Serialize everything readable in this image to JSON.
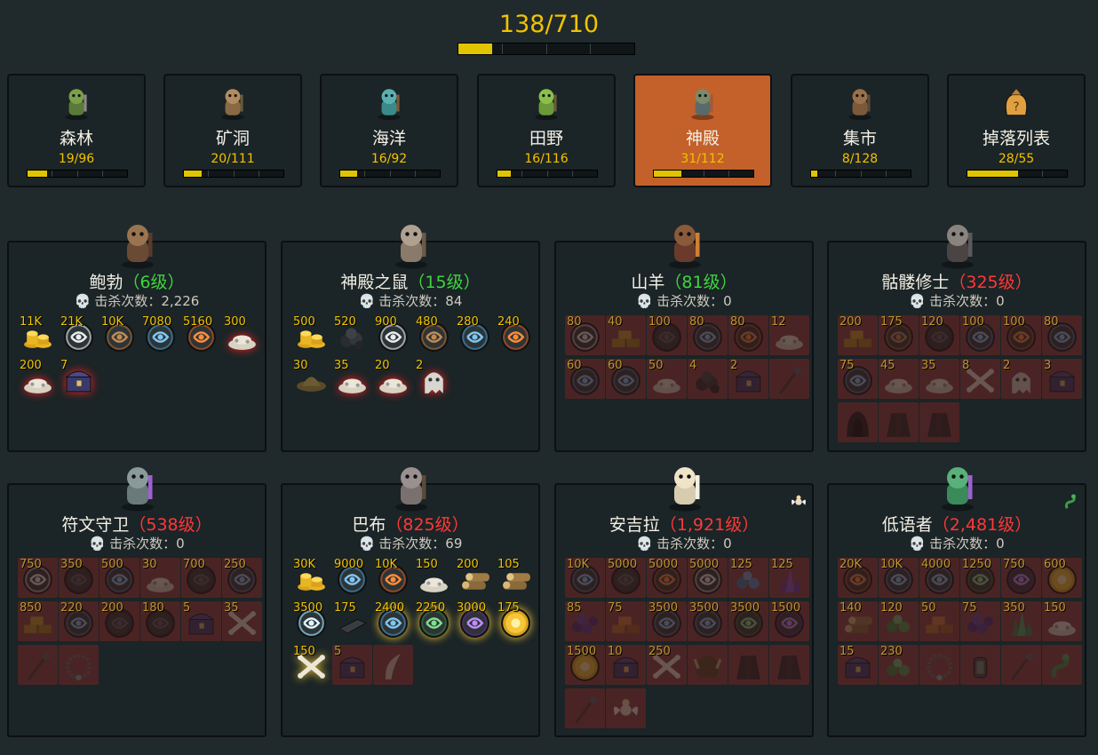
{
  "progress": {
    "label": "138/710",
    "fraction": 0.194
  },
  "areas": [
    {
      "name": "森林",
      "count": "19/96",
      "fraction": 0.198,
      "icon": "goblin-axe-icon",
      "active": false
    },
    {
      "name": "矿洞",
      "count": "20/111",
      "fraction": 0.18,
      "icon": "scarecrow-icon",
      "active": false
    },
    {
      "name": "海洋",
      "count": "16/92",
      "fraction": 0.174,
      "icon": "sea-goblin-icon",
      "active": false
    },
    {
      "name": "田野",
      "count": "16/116",
      "fraction": 0.138,
      "icon": "field-goblin-icon",
      "active": false
    },
    {
      "name": "神殿",
      "count": "31/112",
      "fraction": 0.277,
      "icon": "temple-monster-icon",
      "active": true
    },
    {
      "name": "集市",
      "count": "8/128",
      "fraction": 0.0625,
      "icon": "market-monster-icon",
      "active": false
    },
    {
      "name": "掉落列表",
      "count": "28/55",
      "fraction": 0.509,
      "icon": "loot-bag-icon",
      "active": false
    }
  ],
  "bosses": [
    {
      "name": "鲍勃",
      "level": "（6级）",
      "level_color": "green",
      "kills_label": "击杀次数：2,226",
      "icon": "scarecrow-boss-icon",
      "pet": null,
      "drops": [
        {
          "qty": "11K",
          "icon": "gold-coins-icon",
          "state": "found"
        },
        {
          "qty": "21K",
          "icon": "silver-rune-icon",
          "state": "found"
        },
        {
          "qty": "10K",
          "icon": "brown-rune-icon",
          "state": "found"
        },
        {
          "qty": "7080",
          "icon": "water-rune-icon",
          "state": "found"
        },
        {
          "qty": "5160",
          "icon": "fire-rune-icon",
          "state": "found"
        },
        {
          "qty": "300",
          "icon": "bone-pile-icon",
          "state": "rare"
        },
        {
          "qty": "200",
          "icon": "bone-pile-icon",
          "state": "rare"
        },
        {
          "qty": "7",
          "icon": "treasure-chest-icon",
          "state": "rare"
        }
      ]
    },
    {
      "name": "神殿之鼠",
      "level": "（15级）",
      "level_color": "green",
      "kills_label": "击杀次数：84",
      "icon": "temple-rat-icon",
      "pet": null,
      "drops": [
        {
          "qty": "500",
          "icon": "gold-coins-icon",
          "state": "found"
        },
        {
          "qty": "520",
          "icon": "coal-icon",
          "state": "found"
        },
        {
          "qty": "900",
          "icon": "silver-rune-icon",
          "state": "found"
        },
        {
          "qty": "480",
          "icon": "brown-rune-icon",
          "state": "found"
        },
        {
          "qty": "280",
          "icon": "water-rune-icon",
          "state": "found"
        },
        {
          "qty": "240",
          "icon": "fire-rune-icon",
          "state": "found"
        },
        {
          "qty": "30",
          "icon": "hat-icon",
          "state": "found"
        },
        {
          "qty": "35",
          "icon": "bone-pile-icon",
          "state": "rare"
        },
        {
          "qty": "20",
          "icon": "bone-pile-icon",
          "state": "rare"
        },
        {
          "qty": "2",
          "icon": "ghost-icon",
          "state": "rare"
        }
      ]
    },
    {
      "name": "山羊",
      "level": "（81级）",
      "level_color": "green",
      "kills_label": "击杀次数：0",
      "icon": "goat-demon-icon",
      "pet": null,
      "drops": [
        {
          "qty": "80",
          "icon": "silver-rune-icon",
          "state": "locked"
        },
        {
          "qty": "40",
          "icon": "gold-bars-icon",
          "state": "locked"
        },
        {
          "qty": "100",
          "icon": "dark-rune-icon",
          "state": "locked"
        },
        {
          "qty": "80",
          "icon": "water-rune-icon",
          "state": "locked"
        },
        {
          "qty": "80",
          "icon": "fire-rune-icon",
          "state": "locked"
        },
        {
          "qty": "12",
          "icon": "bone-pile-icon",
          "state": "locked"
        },
        {
          "qty": "60",
          "icon": "water-rune-icon",
          "state": "locked"
        },
        {
          "qty": "60",
          "icon": "water-rune-icon",
          "state": "locked"
        },
        {
          "qty": "50",
          "icon": "bone-pile-icon",
          "state": "locked"
        },
        {
          "qty": "4",
          "icon": "coal-icon",
          "state": "locked"
        },
        {
          "qty": "2",
          "icon": "treasure-chest-icon",
          "state": "locked"
        },
        {
          "qty": "",
          "icon": "staff-icon",
          "state": "locked"
        }
      ]
    },
    {
      "name": "骷髅修士",
      "level": "（325级）",
      "level_color": "red",
      "kills_label": "击杀次数：0",
      "icon": "skeleton-monk-icon",
      "pet": null,
      "drops": [
        {
          "qty": "200",
          "icon": "gold-bars-icon",
          "state": "locked"
        },
        {
          "qty": "175",
          "icon": "brown-rune-icon",
          "state": "locked"
        },
        {
          "qty": "120",
          "icon": "dark-rune-icon",
          "state": "locked"
        },
        {
          "qty": "100",
          "icon": "water-rune-icon",
          "state": "locked"
        },
        {
          "qty": "100",
          "icon": "fire-rune-icon",
          "state": "locked"
        },
        {
          "qty": "80",
          "icon": "water-rune-icon",
          "state": "locked"
        },
        {
          "qty": "75",
          "icon": "water-rune-icon",
          "state": "locked"
        },
        {
          "qty": "45",
          "icon": "bone-pile-icon",
          "state": "locked"
        },
        {
          "qty": "35",
          "icon": "bone-pile-icon",
          "state": "locked"
        },
        {
          "qty": "8",
          "icon": "crossbones-icon",
          "state": "locked"
        },
        {
          "qty": "2",
          "icon": "ghost-icon",
          "state": "locked"
        },
        {
          "qty": "3",
          "icon": "treasure-chest-icon",
          "state": "locked"
        },
        {
          "qty": "",
          "icon": "hood-icon",
          "state": "locked"
        },
        {
          "qty": "",
          "icon": "robe-icon",
          "state": "locked"
        },
        {
          "qty": "",
          "icon": "robe-icon",
          "state": "locked"
        }
      ]
    },
    {
      "name": "符文守卫",
      "level": "（538级）",
      "level_color": "red",
      "kills_label": "击杀次数：0",
      "icon": "rune-guardian-icon",
      "pet": null,
      "drops": [
        {
          "qty": "750",
          "icon": "silver-rune-icon",
          "state": "locked"
        },
        {
          "qty": "350",
          "icon": "dark-rune-icon",
          "state": "locked"
        },
        {
          "qty": "500",
          "icon": "water-rune-icon",
          "state": "locked"
        },
        {
          "qty": "30",
          "icon": "bone-pile-icon",
          "state": "locked"
        },
        {
          "qty": "700",
          "icon": "dark-rune-icon",
          "state": "locked"
        },
        {
          "qty": "250",
          "icon": "water-rune-icon",
          "state": "locked"
        },
        {
          "qty": "850",
          "icon": "gold-bars-icon",
          "state": "locked"
        },
        {
          "qty": "220",
          "icon": "water-rune-icon",
          "state": "locked"
        },
        {
          "qty": "200",
          "icon": "dark-rune-icon",
          "state": "locked"
        },
        {
          "qty": "180",
          "icon": "dark-rune-icon",
          "state": "locked"
        },
        {
          "qty": "5",
          "icon": "treasure-chest-icon",
          "state": "locked"
        },
        {
          "qty": "35",
          "icon": "crossbones-icon",
          "state": "locked"
        },
        {
          "qty": "",
          "icon": "staff-icon",
          "state": "locked"
        },
        {
          "qty": "",
          "icon": "necklace-icon",
          "state": "locked"
        }
      ]
    },
    {
      "name": "巴布",
      "level": "（825级）",
      "level_color": "red",
      "kills_label": "击杀次数：69",
      "icon": "elephant-warrior-icon",
      "pet": null,
      "drops": [
        {
          "qty": "30K",
          "icon": "gold-coins-icon",
          "state": "found"
        },
        {
          "qty": "9000",
          "icon": "water-rune-icon",
          "state": "found"
        },
        {
          "qty": "10K",
          "icon": "fire-rune-icon",
          "state": "found"
        },
        {
          "qty": "150",
          "icon": "bone-pile-icon",
          "state": "found"
        },
        {
          "qty": "200",
          "icon": "logs-icon",
          "state": "found"
        },
        {
          "qty": "105",
          "icon": "logs-icon",
          "state": "found"
        },
        {
          "qty": "3500",
          "icon": "air-rune-icon",
          "state": "found"
        },
        {
          "qty": "175",
          "icon": "iron-bar-icon",
          "state": "found"
        },
        {
          "qty": "2400",
          "icon": "water-rune-icon",
          "state": "epic"
        },
        {
          "qty": "2250",
          "icon": "nature-rune-icon",
          "state": "epic"
        },
        {
          "qty": "3000",
          "icon": "chaos-rune-icon",
          "state": "epic"
        },
        {
          "qty": "175",
          "icon": "sun-rune-icon",
          "state": "epic"
        },
        {
          "qty": "150",
          "icon": "crossbones-icon",
          "state": "epic"
        },
        {
          "qty": "5",
          "icon": "treasure-chest-icon",
          "state": "locked"
        },
        {
          "qty": "",
          "icon": "tusk-icon",
          "state": "locked"
        }
      ]
    },
    {
      "name": "安吉拉",
      "level": "（1,921级）",
      "level_color": "red",
      "kills_label": "击杀次数：0",
      "icon": "angel-icon",
      "pet": "angel-pet-icon",
      "drops": [
        {
          "qty": "10K",
          "icon": "water-rune-icon",
          "state": "locked"
        },
        {
          "qty": "5000",
          "icon": "dark-rune-icon",
          "state": "locked"
        },
        {
          "qty": "5000",
          "icon": "fire-rune-icon",
          "state": "locked"
        },
        {
          "qty": "5000",
          "icon": "silver-rune-icon",
          "state": "locked"
        },
        {
          "qty": "125",
          "icon": "blue-gems-icon",
          "state": "locked"
        },
        {
          "qty": "125",
          "icon": "purple-crystal-icon",
          "state": "locked"
        },
        {
          "qty": "85",
          "icon": "berries-icon",
          "state": "locked"
        },
        {
          "qty": "75",
          "icon": "copper-bars-icon",
          "state": "locked"
        },
        {
          "qty": "3500",
          "icon": "water-rune-icon",
          "state": "locked"
        },
        {
          "qty": "3500",
          "icon": "water-rune-icon",
          "state": "locked"
        },
        {
          "qty": "3500",
          "icon": "nature-rune-icon",
          "state": "locked"
        },
        {
          "qty": "1500",
          "icon": "chaos-rune-icon",
          "state": "locked"
        },
        {
          "qty": "1500",
          "icon": "sun-rune-icon",
          "state": "locked"
        },
        {
          "qty": "10",
          "icon": "treasure-chest-icon",
          "state": "locked"
        },
        {
          "qty": "250",
          "icon": "crossbones-icon",
          "state": "locked"
        },
        {
          "qty": "",
          "icon": "helmet-icon",
          "state": "locked"
        },
        {
          "qty": "",
          "icon": "robe-icon",
          "state": "locked"
        },
        {
          "qty": "",
          "icon": "robe-icon",
          "state": "locked"
        },
        {
          "qty": "",
          "icon": "staff-icon",
          "state": "locked"
        },
        {
          "qty": "",
          "icon": "angel-pet-icon",
          "state": "locked"
        }
      ]
    },
    {
      "name": "低语者",
      "level": "（2,481级）",
      "level_color": "red",
      "kills_label": "击杀次数：0",
      "icon": "naga-icon",
      "pet": "snake-pet-icon",
      "drops": [
        {
          "qty": "20K",
          "icon": "fire-rune-icon",
          "state": "locked"
        },
        {
          "qty": "10K",
          "icon": "water-rune-icon",
          "state": "locked"
        },
        {
          "qty": "4000",
          "icon": "water-rune-icon",
          "state": "locked"
        },
        {
          "qty": "1250",
          "icon": "nature-rune-icon",
          "state": "locked"
        },
        {
          "qty": "750",
          "icon": "chaos-rune-icon",
          "state": "locked"
        },
        {
          "qty": "600",
          "icon": "sun-rune-icon",
          "state": "locked"
        },
        {
          "qty": "140",
          "icon": "logs-icon",
          "state": "locked"
        },
        {
          "qty": "120",
          "icon": "green-gems-icon",
          "state": "locked"
        },
        {
          "qty": "50",
          "icon": "copper-bars-icon",
          "state": "locked"
        },
        {
          "qty": "75",
          "icon": "berries-icon",
          "state": "locked"
        },
        {
          "qty": "350",
          "icon": "green-crystal-icon",
          "state": "locked"
        },
        {
          "qty": "150",
          "icon": "bone-pile-icon",
          "state": "locked"
        },
        {
          "qty": "15",
          "icon": "treasure-chest-icon",
          "state": "locked"
        },
        {
          "qty": "230",
          "icon": "green-gems-icon",
          "state": "locked"
        },
        {
          "qty": "",
          "icon": "necklace-icon",
          "state": "locked"
        },
        {
          "qty": "",
          "icon": "lantern-icon",
          "state": "locked"
        },
        {
          "qty": "",
          "icon": "staff-icon",
          "state": "locked"
        },
        {
          "qty": "",
          "icon": "snake-pet-icon",
          "state": "locked"
        }
      ]
    }
  ],
  "colors": {
    "gold": "#f2c200",
    "level_green": "#3fd43f",
    "level_red": "#ff3838",
    "active_tab": "#c4602a",
    "locked_slot": "#4a2424"
  }
}
